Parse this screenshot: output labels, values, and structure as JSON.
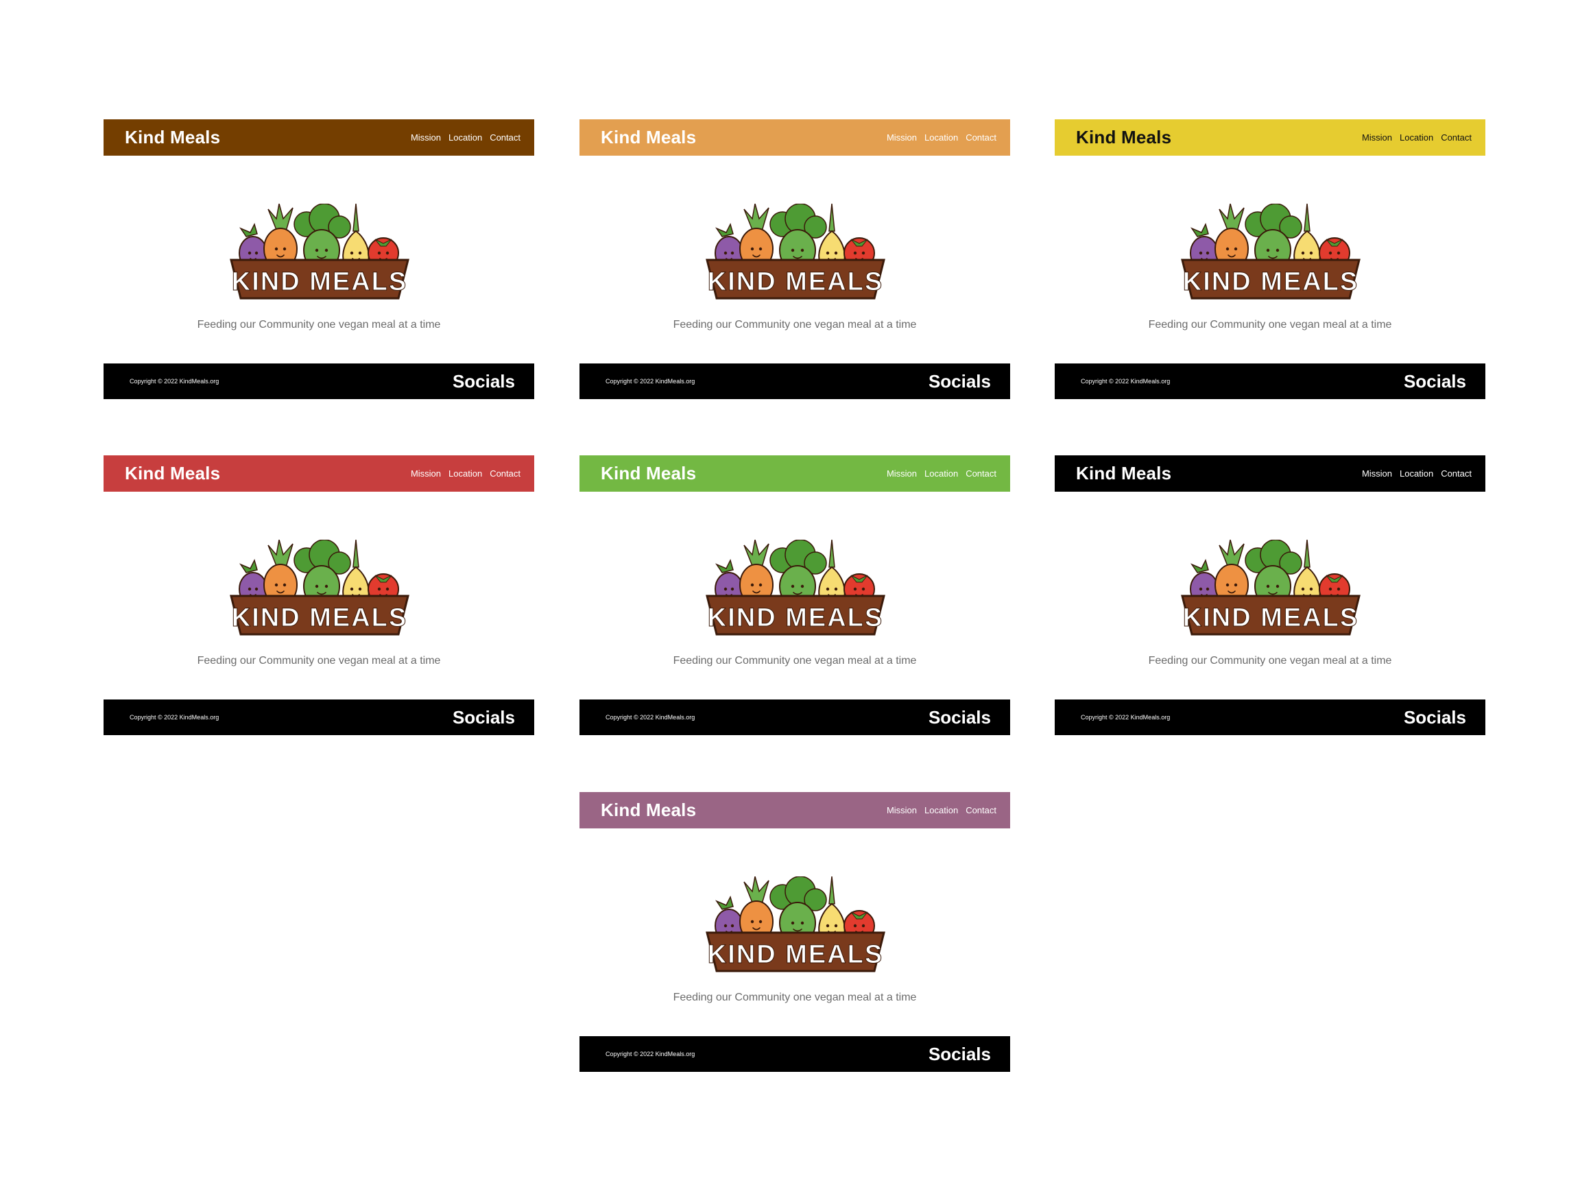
{
  "site": {
    "brand": "Kind Meals",
    "nav_links": [
      "Mission",
      "Location",
      "Contact"
    ],
    "logo_text": "KIND MEALS",
    "tagline": "Feeding our Community one vegan meal at a time",
    "copyright": "Copyright © 2022 KindMeals.org",
    "socials": "Socials"
  },
  "variants": [
    {
      "id": "brown",
      "header_bg": "#743e00",
      "header_text": "#ffffff"
    },
    {
      "id": "orange",
      "header_bg": "#e39f50",
      "header_text": "#ffffff"
    },
    {
      "id": "yellow",
      "header_bg": "#e6cc30",
      "header_text": "#111111"
    },
    {
      "id": "red",
      "header_bg": "#c73e3e",
      "header_text": "#ffffff"
    },
    {
      "id": "green",
      "header_bg": "#73b843",
      "header_text": "#ffffff"
    },
    {
      "id": "black",
      "header_bg": "#000000",
      "header_text": "#ffffff"
    },
    {
      "id": "purple",
      "header_bg": "#9a6585",
      "header_text": "#ffffff"
    }
  ],
  "logo_colors": {
    "basket": "#7a3a1c",
    "basket_outline": "#3a1a0a",
    "eggplant": "#8e5aa8",
    "carrot": "#ee9142",
    "broccoli": "#6ab04c",
    "onion": "#f7dc72",
    "tomato": "#e23b2e",
    "leaf": "#4e9b34"
  }
}
